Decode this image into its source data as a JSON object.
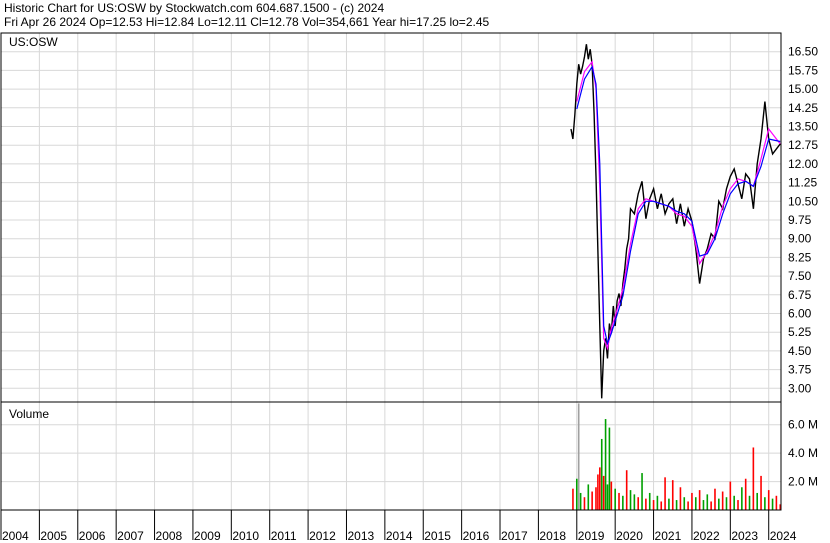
{
  "header": {
    "line1": "Historic Chart for US:OSW by Stockwatch.com 604.687.1500 - (c) 2024",
    "line2": "Fri Apr 26 2024   Op=12.53   Hi=12.84   Lo=12.11   Cl=12.78   Vol=354,661   Year hi=17.25   lo=2.45"
  },
  "chart_data": [
    {
      "type": "line",
      "panel": "price",
      "label": "US:OSW",
      "ylim": [
        2.45,
        17.25
      ],
      "yticks": [
        16.5,
        15.75,
        15.0,
        14.25,
        13.5,
        12.75,
        12.0,
        11.25,
        10.5,
        9.75,
        9.0,
        8.25,
        7.5,
        6.75,
        6.0,
        5.25,
        4.5,
        3.75,
        3.0
      ],
      "ytick_labels": [
        "16.50",
        "15.75",
        "15.00",
        "14.25",
        "13.50",
        "12.75",
        "12.00",
        "11.25",
        "10.50",
        "9.75",
        "9.00",
        "8.25",
        "7.50",
        "6.75",
        "6.00",
        "5.25",
        "4.50",
        "3.75",
        "3.00"
      ],
      "grid": true,
      "x_labels": [
        "2004",
        "2005",
        "2006",
        "2007",
        "2008",
        "2009",
        "2010",
        "2011",
        "2012",
        "2013",
        "2014",
        "2015",
        "2016",
        "2017",
        "2018",
        "2019",
        "2020",
        "2021",
        "2022",
        "2023",
        "2024"
      ],
      "series": [
        {
          "role": "price",
          "color": "#000000",
          "x": [
            2018.85,
            2018.9,
            2018.95,
            2019.0,
            2019.05,
            2019.1,
            2019.15,
            2019.2,
            2019.25,
            2019.3,
            2019.35,
            2019.4,
            2019.45,
            2019.5,
            2019.55,
            2019.6,
            2019.65,
            2019.7,
            2019.75,
            2019.8,
            2019.85,
            2019.9,
            2019.95,
            2020.0,
            2020.05,
            2020.1,
            2020.15,
            2020.2,
            2020.25,
            2020.3,
            2020.35,
            2020.4,
            2020.5,
            2020.6,
            2020.7,
            2020.8,
            2020.9,
            2021.0,
            2021.1,
            2021.2,
            2021.3,
            2021.4,
            2021.5,
            2021.6,
            2021.7,
            2021.8,
            2021.9,
            2022.0,
            2022.1,
            2022.2,
            2022.3,
            2022.4,
            2022.5,
            2022.6,
            2022.7,
            2022.8,
            2022.9,
            2023.0,
            2023.1,
            2023.2,
            2023.3,
            2023.4,
            2023.5,
            2023.6,
            2023.7,
            2023.8,
            2023.9,
            2024.0,
            2024.1,
            2024.2,
            2024.3
          ],
          "values": [
            13.4,
            13.0,
            14.0,
            15.2,
            16.0,
            15.6,
            15.9,
            16.3,
            16.8,
            16.2,
            16.6,
            16.0,
            14.0,
            11.5,
            8.5,
            5.5,
            2.6,
            4.5,
            5.0,
            4.2,
            5.6,
            5.2,
            6.3,
            5.5,
            6.5,
            6.8,
            6.3,
            7.2,
            7.8,
            8.6,
            9.0,
            10.2,
            10.0,
            10.8,
            11.3,
            9.8,
            10.6,
            11.0,
            10.2,
            10.8,
            10.0,
            10.4,
            10.6,
            9.6,
            10.4,
            9.5,
            10.2,
            9.7,
            8.6,
            7.2,
            8.2,
            8.6,
            9.2,
            9.0,
            10.5,
            10.2,
            11.0,
            11.5,
            11.8,
            11.2,
            10.6,
            11.6,
            11.4,
            10.2,
            12.0,
            13.0,
            14.5,
            13.0,
            12.4,
            12.6,
            12.8
          ]
        },
        {
          "role": "moving-average-1",
          "color": "#ff00ff",
          "x": [
            2019.0,
            2019.2,
            2019.4,
            2019.5,
            2019.6,
            2019.7,
            2019.8,
            2019.9,
            2020.0,
            2020.2,
            2020.4,
            2020.6,
            2020.8,
            2021.0,
            2021.2,
            2021.4,
            2021.6,
            2021.8,
            2022.0,
            2022.2,
            2022.4,
            2022.6,
            2022.8,
            2023.0,
            2023.2,
            2023.4,
            2023.6,
            2023.8,
            2024.0,
            2024.3
          ],
          "values": [
            14.5,
            15.7,
            16.1,
            15.0,
            11.0,
            5.0,
            4.6,
            5.4,
            5.9,
            7.0,
            8.8,
            10.2,
            10.6,
            10.5,
            10.4,
            10.3,
            10.0,
            9.9,
            9.5,
            8.0,
            8.5,
            9.2,
            10.3,
            11.0,
            11.4,
            11.3,
            11.1,
            12.2,
            13.4,
            12.8
          ]
        },
        {
          "role": "moving-average-2",
          "color": "#0000ff",
          "x": [
            2019.0,
            2019.2,
            2019.4,
            2019.5,
            2019.6,
            2019.7,
            2019.8,
            2019.9,
            2020.0,
            2020.2,
            2020.4,
            2020.6,
            2020.8,
            2021.0,
            2021.2,
            2021.4,
            2021.6,
            2021.8,
            2022.0,
            2022.2,
            2022.4,
            2022.6,
            2022.8,
            2023.0,
            2023.2,
            2023.4,
            2023.6,
            2023.8,
            2024.0,
            2024.3
          ],
          "values": [
            14.2,
            15.4,
            15.9,
            15.2,
            12.0,
            5.5,
            4.8,
            5.2,
            5.7,
            6.7,
            8.5,
            10.0,
            10.5,
            10.5,
            10.4,
            10.3,
            10.1,
            10.0,
            9.7,
            8.3,
            8.4,
            9.0,
            10.0,
            10.8,
            11.2,
            11.3,
            11.1,
            11.9,
            13.0,
            12.9
          ]
        }
      ]
    },
    {
      "type": "bar",
      "panel": "volume",
      "label": "Volume",
      "ylim": [
        0,
        7.6
      ],
      "yticks": [
        2.0,
        4.0,
        6.0
      ],
      "ytick_labels": [
        "2.0 M",
        "4.0 M",
        "6.0 M"
      ],
      "grid": true,
      "colors": {
        "up": "#00a000",
        "down": "#ff0000",
        "neutral": "#a0a0a0"
      },
      "bars": [
        {
          "x": 2018.9,
          "value": 1.5,
          "c": "down"
        },
        {
          "x": 2019.0,
          "value": 2.2,
          "c": "up"
        },
        {
          "x": 2019.05,
          "value": 7.5,
          "c": "neutral"
        },
        {
          "x": 2019.1,
          "value": 1.2,
          "c": "up"
        },
        {
          "x": 2019.2,
          "value": 0.9,
          "c": "down"
        },
        {
          "x": 2019.3,
          "value": 1.8,
          "c": "up"
        },
        {
          "x": 2019.4,
          "value": 1.3,
          "c": "down"
        },
        {
          "x": 2019.5,
          "value": 1.6,
          "c": "down"
        },
        {
          "x": 2019.55,
          "value": 2.5,
          "c": "down"
        },
        {
          "x": 2019.6,
          "value": 3.0,
          "c": "down"
        },
        {
          "x": 2019.65,
          "value": 5.0,
          "c": "up"
        },
        {
          "x": 2019.7,
          "value": 2.4,
          "c": "down"
        },
        {
          "x": 2019.75,
          "value": 6.4,
          "c": "up"
        },
        {
          "x": 2019.8,
          "value": 1.8,
          "c": "up"
        },
        {
          "x": 2019.85,
          "value": 5.8,
          "c": "up"
        },
        {
          "x": 2019.9,
          "value": 2.0,
          "c": "down"
        },
        {
          "x": 2020.0,
          "value": 1.5,
          "c": "up"
        },
        {
          "x": 2020.1,
          "value": 1.2,
          "c": "down"
        },
        {
          "x": 2020.2,
          "value": 1.0,
          "c": "up"
        },
        {
          "x": 2020.3,
          "value": 2.8,
          "c": "down"
        },
        {
          "x": 2020.4,
          "value": 1.4,
          "c": "up"
        },
        {
          "x": 2020.5,
          "value": 1.1,
          "c": "up"
        },
        {
          "x": 2020.6,
          "value": 0.9,
          "c": "down"
        },
        {
          "x": 2020.7,
          "value": 2.6,
          "c": "up"
        },
        {
          "x": 2020.8,
          "value": 0.8,
          "c": "down"
        },
        {
          "x": 2020.9,
          "value": 1.2,
          "c": "up"
        },
        {
          "x": 2021.0,
          "value": 0.7,
          "c": "down"
        },
        {
          "x": 2021.1,
          "value": 1.0,
          "c": "up"
        },
        {
          "x": 2021.2,
          "value": 0.6,
          "c": "down"
        },
        {
          "x": 2021.3,
          "value": 2.3,
          "c": "down"
        },
        {
          "x": 2021.4,
          "value": 0.8,
          "c": "up"
        },
        {
          "x": 2021.5,
          "value": 2.1,
          "c": "down"
        },
        {
          "x": 2021.6,
          "value": 0.7,
          "c": "up"
        },
        {
          "x": 2021.7,
          "value": 1.6,
          "c": "down"
        },
        {
          "x": 2021.8,
          "value": 0.9,
          "c": "up"
        },
        {
          "x": 2021.9,
          "value": 0.6,
          "c": "down"
        },
        {
          "x": 2022.0,
          "value": 1.2,
          "c": "down"
        },
        {
          "x": 2022.1,
          "value": 0.9,
          "c": "up"
        },
        {
          "x": 2022.2,
          "value": 1.4,
          "c": "down"
        },
        {
          "x": 2022.3,
          "value": 0.7,
          "c": "up"
        },
        {
          "x": 2022.4,
          "value": 1.1,
          "c": "up"
        },
        {
          "x": 2022.5,
          "value": 0.6,
          "c": "down"
        },
        {
          "x": 2022.6,
          "value": 1.5,
          "c": "down"
        },
        {
          "x": 2022.7,
          "value": 0.8,
          "c": "up"
        },
        {
          "x": 2022.8,
          "value": 1.3,
          "c": "down"
        },
        {
          "x": 2022.9,
          "value": 0.9,
          "c": "up"
        },
        {
          "x": 2023.0,
          "value": 2.0,
          "c": "down"
        },
        {
          "x": 2023.1,
          "value": 1.0,
          "c": "up"
        },
        {
          "x": 2023.2,
          "value": 0.7,
          "c": "down"
        },
        {
          "x": 2023.3,
          "value": 1.6,
          "c": "up"
        },
        {
          "x": 2023.4,
          "value": 2.2,
          "c": "down"
        },
        {
          "x": 2023.5,
          "value": 1.0,
          "c": "up"
        },
        {
          "x": 2023.6,
          "value": 4.4,
          "c": "down"
        },
        {
          "x": 2023.7,
          "value": 1.2,
          "c": "up"
        },
        {
          "x": 2023.8,
          "value": 2.4,
          "c": "down"
        },
        {
          "x": 2023.9,
          "value": 0.9,
          "c": "up"
        },
        {
          "x": 2024.0,
          "value": 1.4,
          "c": "down"
        },
        {
          "x": 2024.1,
          "value": 0.8,
          "c": "up"
        },
        {
          "x": 2024.2,
          "value": 1.0,
          "c": "down"
        },
        {
          "x": 2024.3,
          "value": 0.4,
          "c": "down"
        }
      ]
    }
  ]
}
